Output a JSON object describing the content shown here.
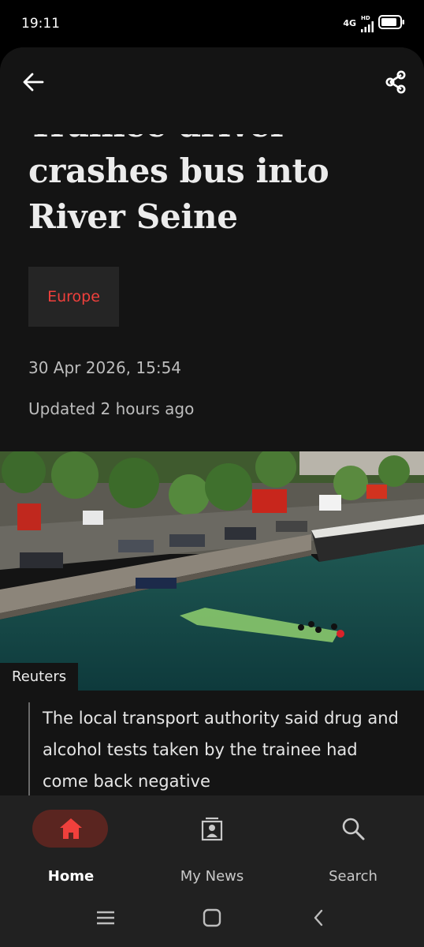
{
  "status_bar": {
    "time": "19:11",
    "network": "4G",
    "network_badge": "HD",
    "icons": [
      "signal-icon",
      "battery-icon"
    ]
  },
  "toolbar": {
    "back_icon": "arrow-left-icon",
    "share_icon": "share-icon"
  },
  "article": {
    "headline": "Trainee driver crashes bus into River Seine",
    "section_tag": "Europe",
    "date": "30 Apr 2026, 15:54",
    "updated": "Updated 2 hours ago",
    "image_credit": "Reuters",
    "image_caption": "The local transport authority said drug and alcohol tests taken by the trainee had come back negative"
  },
  "bottom_nav": {
    "items": [
      {
        "label": "Home",
        "icon": "home-icon",
        "active": true
      },
      {
        "label": "My News",
        "icon": "my-news-icon",
        "active": false
      },
      {
        "label": "Search",
        "icon": "search-icon",
        "active": false
      }
    ]
  },
  "system_nav": {
    "icons": [
      "menu-icon",
      "home-square-icon",
      "back-chevron-icon"
    ]
  },
  "colors": {
    "background": "#141414",
    "accent_red": "#f0403c",
    "nav_background": "#212121",
    "active_pill": "#5a2520"
  }
}
